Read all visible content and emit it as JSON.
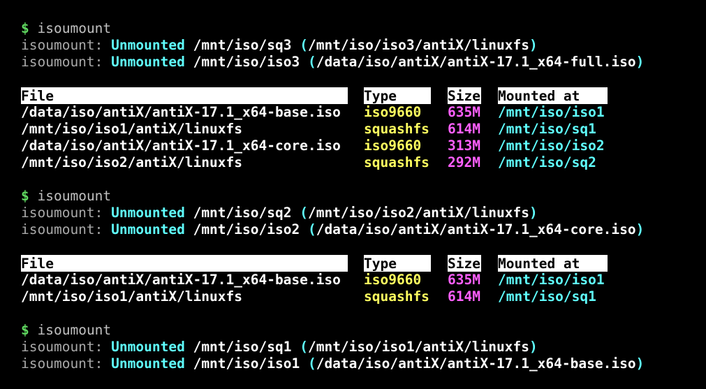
{
  "colors": {
    "background": "#000000",
    "prompt": "#5fd75f",
    "unmounted": "#5fffff",
    "type": "#ffff5f",
    "size": "#ff5fff",
    "mounted_at": "#5fffff"
  },
  "blocks": [
    {
      "prompt": "$",
      "command": "isoumount",
      "messages": [
        {
          "tool": "isoumount:",
          "status": "Unmounted",
          "target": "/mnt/iso/sq3",
          "open": "(",
          "source": "/mnt/iso/iso3/antiX/linuxfs",
          "close": ")"
        },
        {
          "tool": "isoumount:",
          "status": "Unmounted",
          "target": "/mnt/iso/iso3",
          "open": "(",
          "source": "/data/iso/antiX/antiX-17.1_x64-full.iso",
          "close": ")"
        }
      ],
      "table": {
        "headers": {
          "file": "File",
          "type": "Type",
          "size": "Size",
          "mounted_at": "Mounted at"
        },
        "rows": [
          {
            "file": "/data/iso/antiX/antiX-17.1_x64-base.iso",
            "type": "iso9660",
            "size": "635M",
            "mounted_at": "/mnt/iso/iso1"
          },
          {
            "file": "/mnt/iso/iso1/antiX/linuxfs",
            "type": "squashfs",
            "size": "614M",
            "mounted_at": "/mnt/iso/sq1"
          },
          {
            "file": "/data/iso/antiX/antiX-17.1_x64-core.iso",
            "type": "iso9660",
            "size": "313M",
            "mounted_at": "/mnt/iso/iso2"
          },
          {
            "file": "/mnt/iso/iso2/antiX/linuxfs",
            "type": "squashfs",
            "size": "292M",
            "mounted_at": "/mnt/iso/sq2"
          }
        ]
      }
    },
    {
      "prompt": "$",
      "command": "isoumount",
      "messages": [
        {
          "tool": "isoumount:",
          "status": "Unmounted",
          "target": "/mnt/iso/sq2",
          "open": "(",
          "source": "/mnt/iso/iso2/antiX/linuxfs",
          "close": ")"
        },
        {
          "tool": "isoumount:",
          "status": "Unmounted",
          "target": "/mnt/iso/iso2",
          "open": "(",
          "source": "/data/iso/antiX/antiX-17.1_x64-core.iso",
          "close": ")"
        }
      ],
      "table": {
        "headers": {
          "file": "File",
          "type": "Type",
          "size": "Size",
          "mounted_at": "Mounted at"
        },
        "rows": [
          {
            "file": "/data/iso/antiX/antiX-17.1_x64-base.iso",
            "type": "iso9660",
            "size": "635M",
            "mounted_at": "/mnt/iso/iso1"
          },
          {
            "file": "/mnt/iso/iso1/antiX/linuxfs",
            "type": "squashfs",
            "size": "614M",
            "mounted_at": "/mnt/iso/sq1"
          }
        ]
      }
    },
    {
      "prompt": "$",
      "command": "isoumount",
      "messages": [
        {
          "tool": "isoumount:",
          "status": "Unmounted",
          "target": "/mnt/iso/sq1",
          "open": "(",
          "source": "/mnt/iso/iso1/antiX/linuxfs",
          "close": ")"
        },
        {
          "tool": "isoumount:",
          "status": "Unmounted",
          "target": "/mnt/iso/iso1",
          "open": "(",
          "source": "/data/iso/antiX/antiX-17.1_x64-base.iso",
          "close": ")"
        }
      ]
    }
  ]
}
